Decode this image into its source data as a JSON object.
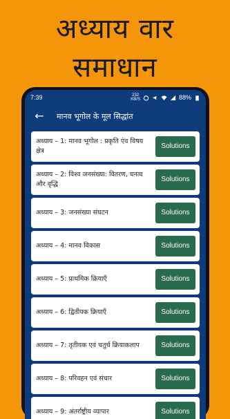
{
  "promo": {
    "line1": "अध्याय वार",
    "line2": "समाधान"
  },
  "status": {
    "time": "7:39",
    "kb_top": "232",
    "kb_bottom": "KB/S",
    "battery": "88%"
  },
  "appbar": {
    "title": "मानव भूगोल के मूल सिद्धांत",
    "back_icon": "arrow-back-icon"
  },
  "chapters": [
    {
      "label": "अध्याय – 1: मानव भूगोल : प्रकृति एंव विषय क्षेत्र",
      "button": "Solutions"
    },
    {
      "label": "अध्याय – 2: विश्व जनसंख्या: वितरण, घनत्व और वृद्धि",
      "button": "Solutions"
    },
    {
      "label": "अध्याय – 3: जनसंख्या संघटन",
      "button": "Solutions"
    },
    {
      "label": "अध्याय – 4: मानव विकास",
      "button": "Solutions"
    },
    {
      "label": "अध्याय – 5: प्राथमिक क्रियाएँ",
      "button": "Solutions"
    },
    {
      "label": "अध्याय – 6: द्वितीयक क्रियाएँ",
      "button": "Solutions"
    },
    {
      "label": "अध्याय – 7: तृतीयक एवं चतुर्थ क्रियाकलाप",
      "button": "Solutions"
    },
    {
      "label": "अध्याय – 8: परिवहन एवं संचार",
      "button": "Solutions"
    },
    {
      "label": "अध्याय – 9: अंतर्राष्ट्रीय व्यापार",
      "button": "Solutions"
    }
  ]
}
